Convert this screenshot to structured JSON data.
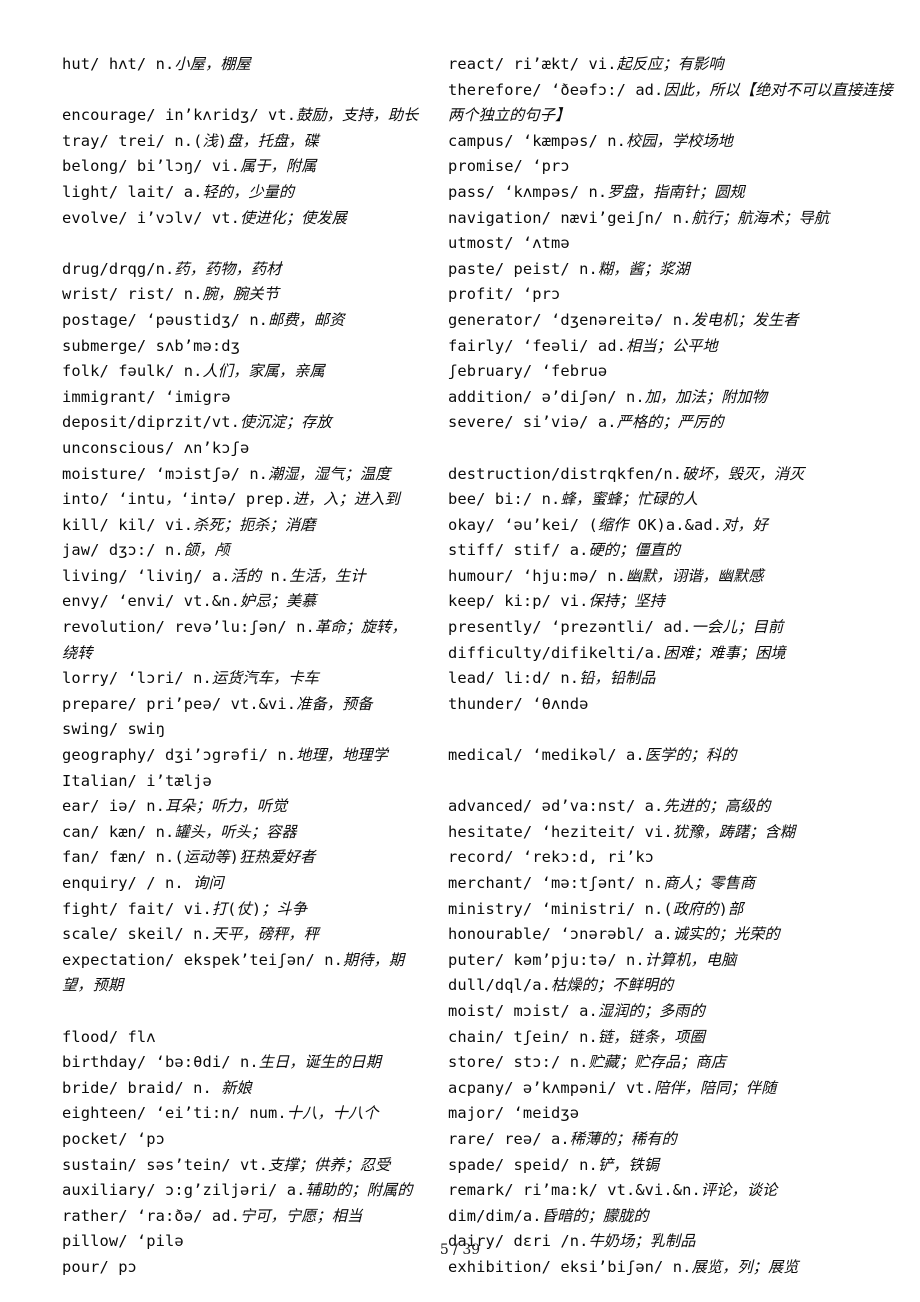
{
  "document": {
    "type": "vocabulary-word-list",
    "page_label": "5 / 39",
    "page_number": 5,
    "total_pages": 39,
    "columns": 2
  },
  "left_column": [
    {
      "kind": "entry",
      "text": "hut/ hʌt/ n.小屋，棚屋"
    },
    {
      "kind": "spacer"
    },
    {
      "kind": "entry",
      "text": "encourage/ in’kʌridʒ/ vt.鼓励，支持，助长"
    },
    {
      "kind": "entry",
      "text": "tray/ trei/ n.(浅)盘，托盘，碟"
    },
    {
      "kind": "entry",
      "text": "belong/ bi’lɔŋ/ vi.属于，附属"
    },
    {
      "kind": "entry",
      "text": "light/ lait/ a.轻的，少量的"
    },
    {
      "kind": "entry",
      "text": "evolve/ i’vɔlv/ vt.使进化；使发展"
    },
    {
      "kind": "spacer"
    },
    {
      "kind": "entry",
      "text": "drug/drqg/n.药，药物，药材"
    },
    {
      "kind": "entry",
      "text": "wrist/ rist/ n.腕，腕关节"
    },
    {
      "kind": "entry",
      "text": "postage/ ‘pəustidʒ/ n.邮费，邮资"
    },
    {
      "kind": "entry",
      "text": "submerge/ sʌb’mə:dʒ"
    },
    {
      "kind": "entry",
      "text": "folk/ fəulk/ n.人们，家属，亲属"
    },
    {
      "kind": "entry",
      "text": "immigrant/ ‘imigrə"
    },
    {
      "kind": "entry",
      "text": "deposit/diprzit/vt.使沉淀；存放"
    },
    {
      "kind": "entry",
      "text": "unconscious/ ʌn’kɔʃə"
    },
    {
      "kind": "entry",
      "text": "moisture/ ‘mɔistʃə/ n.潮湿，湿气；温度"
    },
    {
      "kind": "entry",
      "text": "into/ ‘intu，‘intə/ prep.进，入；进入到"
    },
    {
      "kind": "entry",
      "text": "kill/ kil/ vi.杀死；扼杀；消磨"
    },
    {
      "kind": "entry",
      "text": "jaw/ dʒɔ:/ n.颌，颅"
    },
    {
      "kind": "entry",
      "text": "living/ ‘liviŋ/ a.活的 n.生活，生计"
    },
    {
      "kind": "entry",
      "text": "envy/ ‘envi/ vt.&n.妒忌；美慕"
    },
    {
      "kind": "entry",
      "text": "revolution/ revə’lu:ʃən/ n.革命；旋转，绕转"
    },
    {
      "kind": "entry",
      "text": "lorry/ ‘lɔri/ n.运货汽车，卡车"
    },
    {
      "kind": "entry",
      "text": "prepare/ pri’peə/ vt.&vi.准备，预备"
    },
    {
      "kind": "entry",
      "text": "swing/ swiŋ"
    },
    {
      "kind": "entry",
      "text": "geography/ dʒi’ɔgrəfi/ n.地理，地理学"
    },
    {
      "kind": "entry",
      "text": "Italian/ i’tæljə"
    },
    {
      "kind": "entry",
      "text": "ear/ iə/ n.耳朵；听力，听觉"
    },
    {
      "kind": "entry",
      "text": "can/ kæn/ n.罐头，听头；容器"
    },
    {
      "kind": "entry",
      "text": "fan/ fæn/ n.(运动等)狂热爱好者"
    },
    {
      "kind": "entry",
      "text": "enquiry/ / n. 询问"
    },
    {
      "kind": "entry",
      "text": "fight/ fait/ vi.打(仗)；斗争"
    },
    {
      "kind": "entry",
      "text": "scale/ skeil/ n.天平，磅秤，秤"
    },
    {
      "kind": "entry",
      "text": "expectation/ ekspek’teiʃən/ n.期待，期望，预期"
    },
    {
      "kind": "spacer"
    },
    {
      "kind": "entry",
      "text": "flood/ flʌ"
    },
    {
      "kind": "entry",
      "text": "birthday/ ‘bə:θdi/ n.生日，诞生的日期"
    },
    {
      "kind": "entry",
      "text": "bride/ braid/ n. 新娘"
    },
    {
      "kind": "entry",
      "text": "eighteen/ ‘ei’ti:n/ num.十八，十八个"
    },
    {
      "kind": "entry",
      "text": "pocket/ ‘pɔ"
    },
    {
      "kind": "entry",
      "text": "sustain/ səs’tein/ vt.支撑；供养；忍受"
    },
    {
      "kind": "entry",
      "text": "auxiliary/ ɔ:g’ziljəri/ a.辅助的；附属的"
    },
    {
      "kind": "entry",
      "text": "rather/ ‘ra:ðə/ ad.宁可，宁愿；相当"
    },
    {
      "kind": "entry",
      "text": "pillow/ ‘pilə"
    },
    {
      "kind": "entry",
      "text": "pour/ pɔ"
    }
  ],
  "right_column": [
    {
      "kind": "entry",
      "text": "react/ ri’ækt/ vi.起反应；有影响"
    },
    {
      "kind": "entry",
      "text": "therefore/ ‘ðeəfɔ:/ ad.因此，所以【绝对不可以直接连接两个独立的句子】"
    },
    {
      "kind": "entry",
      "text": "campus/ ‘kæmpəs/ n.校园，学校场地"
    },
    {
      "kind": "entry",
      "text": "promise/ ‘prɔ"
    },
    {
      "kind": "entry",
      "text": "pass/ ‘kʌmpəs/ n.罗盘，指南针；圆规"
    },
    {
      "kind": "entry",
      "text": "navigation/ nævi’geiʃn/ n.航行；航海术；导航"
    },
    {
      "kind": "entry",
      "text": "utmost/ ‘ʌtmə"
    },
    {
      "kind": "entry",
      "text": "paste/ peist/ n.糊，酱；浆湖"
    },
    {
      "kind": "entry",
      "text": "profit/ ‘prɔ"
    },
    {
      "kind": "entry",
      "text": "generator/ ‘dʒenəreitə/ n.发电机；发生者"
    },
    {
      "kind": "entry",
      "text": "fairly/ ‘feəli/ ad.相当；公平地"
    },
    {
      "kind": "entry",
      "text": "ʃebruary/ ‘februə"
    },
    {
      "kind": "entry",
      "text": "addition/ ə’diʃən/ n.加，加法；附加物"
    },
    {
      "kind": "entry",
      "text": "severe/ si’viə/ a.严格的；严厉的"
    },
    {
      "kind": "spacer"
    },
    {
      "kind": "entry",
      "text": "destruction/distrqkfen/n.破坏，毁灭，消灭"
    },
    {
      "kind": "entry",
      "text": "bee/ bi:/ n.蜂，蜜蜂；忙碌的人"
    },
    {
      "kind": "entry",
      "text": "okay/ ‘əu’kei/ (缩作 OK)a.&ad.对，好"
    },
    {
      "kind": "entry",
      "text": "stiff/ stif/ a.硬的；僵直的"
    },
    {
      "kind": "entry",
      "text": "humour/ ‘hju:mə/ n.幽默，诩谐，幽默感"
    },
    {
      "kind": "entry",
      "text": "keep/ ki:p/ vi.保持；坚持"
    },
    {
      "kind": "entry",
      "text": "presently/ ‘prezəntli/ ad.一会儿；目前"
    },
    {
      "kind": "entry",
      "text": "difficulty/difikelti/a.困难；难事；困境"
    },
    {
      "kind": "entry",
      "text": "lead/ li:d/ n.铅，铅制品"
    },
    {
      "kind": "entry",
      "text": "thunder/ ‘θʌndə"
    },
    {
      "kind": "spacer"
    },
    {
      "kind": "entry",
      "text": "medical/ ‘medikəl/ a.医学的；科的"
    },
    {
      "kind": "spacer"
    },
    {
      "kind": "entry",
      "text": "advanced/ əd’va:nst/ a.先进的；高级的"
    },
    {
      "kind": "entry",
      "text": "hesitate/ ‘heziteit/ vi.犹豫，踌躇；含糊"
    },
    {
      "kind": "entry",
      "text": "record/ ‘rekɔ:d, ri’kɔ"
    },
    {
      "kind": "entry",
      "text": "merchant/ ‘mə:tʃənt/ n.商人；零售商"
    },
    {
      "kind": "entry",
      "text": "ministry/ ‘ministri/ n.(政府的)部"
    },
    {
      "kind": "entry",
      "text": "honourable/ ‘ɔnərəbl/ a.诚实的；光荣的"
    },
    {
      "kind": "entry",
      "text": "puter/ kəm’pju:tə/ n.计算机，电脑"
    },
    {
      "kind": "entry",
      "text": "dull/dql/a.枯燥的；不鲜明的"
    },
    {
      "kind": "entry",
      "text": "moist/ mɔist/ a.湿润的；多雨的"
    },
    {
      "kind": "entry",
      "text": "chain/ tʃein/ n.链，链条，项圈"
    },
    {
      "kind": "entry",
      "text": "store/ stɔ:/ n.贮藏；贮存品；商店"
    },
    {
      "kind": "entry",
      "text": "acpany/ ə’kʌmpəni/ vt.陪伴，陪同；伴随"
    },
    {
      "kind": "entry",
      "text": "major/ ‘meidʒə"
    },
    {
      "kind": "entry",
      "text": "rare/ reə/ a.稀薄的；稀有的"
    },
    {
      "kind": "entry",
      "text": "spade/ speid/ n.铲，铁锔"
    },
    {
      "kind": "entry",
      "text": "remark/ ri’ma:k/ vt.&vi.&n.评论，谈论"
    },
    {
      "kind": "entry",
      "text": "dim/dim/a.昏暗的；朦胧的"
    },
    {
      "kind": "entry",
      "text": "dairy/ dɛri /n.牛奶场；乳制品"
    },
    {
      "kind": "entry",
      "text": "exhibition/ eksi’biʃən/ n.展览，列；展览"
    }
  ]
}
